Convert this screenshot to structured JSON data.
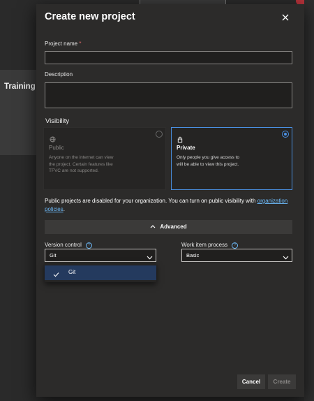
{
  "background": {
    "card_label": "Training"
  },
  "dialog": {
    "title": "Create new project",
    "project_name": {
      "label": "Project name",
      "required_marker": "*",
      "value": ""
    },
    "description": {
      "label": "Description",
      "value": ""
    },
    "visibility": {
      "title": "Visibility",
      "options": [
        {
          "title": "Public",
          "description": "Anyone on the internet can view the project. Certain features like TFVC are not supported.",
          "selected": false,
          "disabled": true,
          "icon": "globe-icon"
        },
        {
          "title": "Private",
          "description": "Only people you give access to will be able to view this project.",
          "selected": true,
          "disabled": false,
          "icon": "lock-icon"
        }
      ]
    },
    "notice": {
      "text": "Public projects are disabled for your organization. You can turn on public visibility with",
      "link": "organization policies",
      "suffix": "."
    },
    "advanced": {
      "label": "Advanced",
      "expanded": true
    },
    "version_control": {
      "label": "Version control",
      "value": "Git",
      "options": [
        "Git"
      ]
    },
    "work_item_process": {
      "label": "Work item process",
      "value": "Basic"
    },
    "buttons": {
      "cancel": "Cancel",
      "create": "Create"
    }
  },
  "colors": {
    "accent": "#4a90e2",
    "link": "#6cb8f6",
    "required": "#e06a6a",
    "selected_option": "#243a5e"
  }
}
